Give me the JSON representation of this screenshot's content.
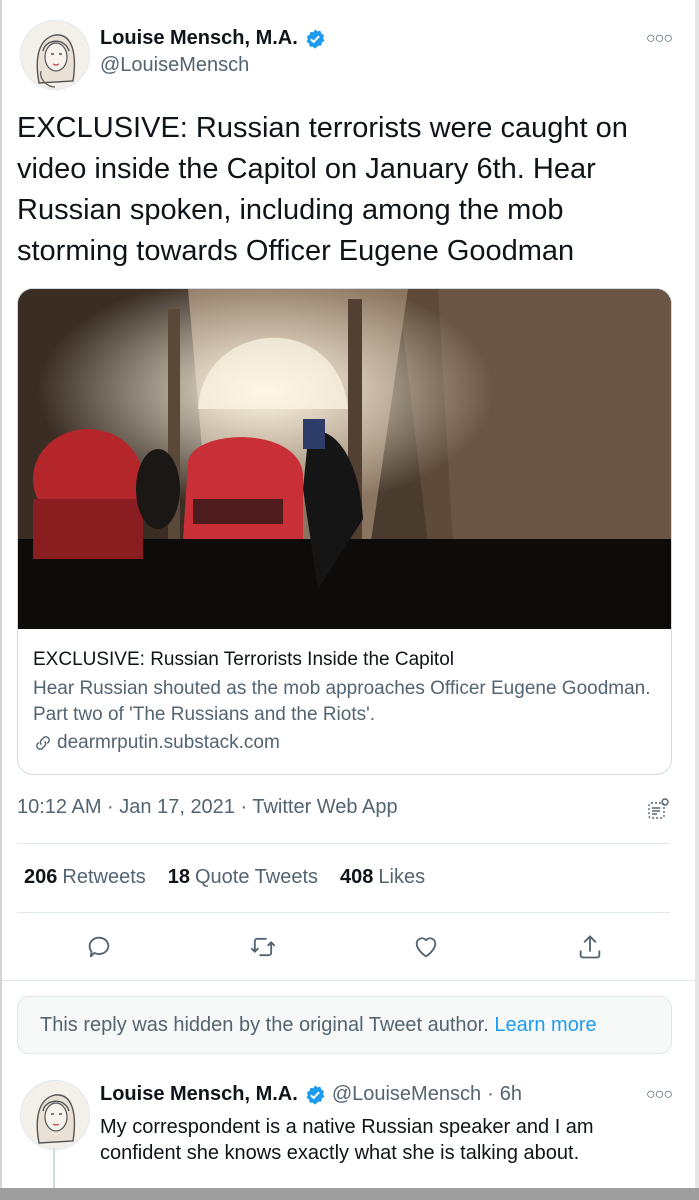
{
  "tweet": {
    "author": {
      "name": "Louise Mensch, M.A.",
      "handle": "@LouiseMensch",
      "verified": true
    },
    "text": "EXCLUSIVE: Russian terrorists were caught on video inside the Capitol on January 6th. Hear Russian spoken, including among the mob storming towards Officer Eugene Goodman",
    "card": {
      "title": "EXCLUSIVE: Russian Terrorists Inside the Capitol",
      "description": "Hear Russian shouted as the mob approaches Officer Eugene Goodman. Part two of 'The Russians and the Riots'.",
      "domain": "dearmrputin.substack.com"
    },
    "timestamp": "10:12 AM · Jan 17, 2021 · Twitter Web App",
    "stats": {
      "retweets_count": "206",
      "retweets_label": "Retweets",
      "quotes_count": "18",
      "quotes_label": "Quote Tweets",
      "likes_count": "408",
      "likes_label": "Likes"
    },
    "actions": [
      "reply-icon",
      "retweet-icon",
      "like-icon",
      "share-icon"
    ]
  },
  "hidden_reply": {
    "text": "This reply was hidden by the original Tweet author.",
    "link": "Learn more"
  },
  "reply": {
    "author": {
      "name": "Louise Mensch, M.A.",
      "handle": "@LouiseMensch",
      "separator": "·",
      "time": "6h",
      "verified": true
    },
    "text": "My correspondent is a native Russian speaker and I am confident she knows exactly what she is talking about."
  },
  "colors": {
    "accent": "#1d9bf0",
    "text": "#0f1419",
    "secondary": "#536471",
    "border": "#cfd9de"
  }
}
